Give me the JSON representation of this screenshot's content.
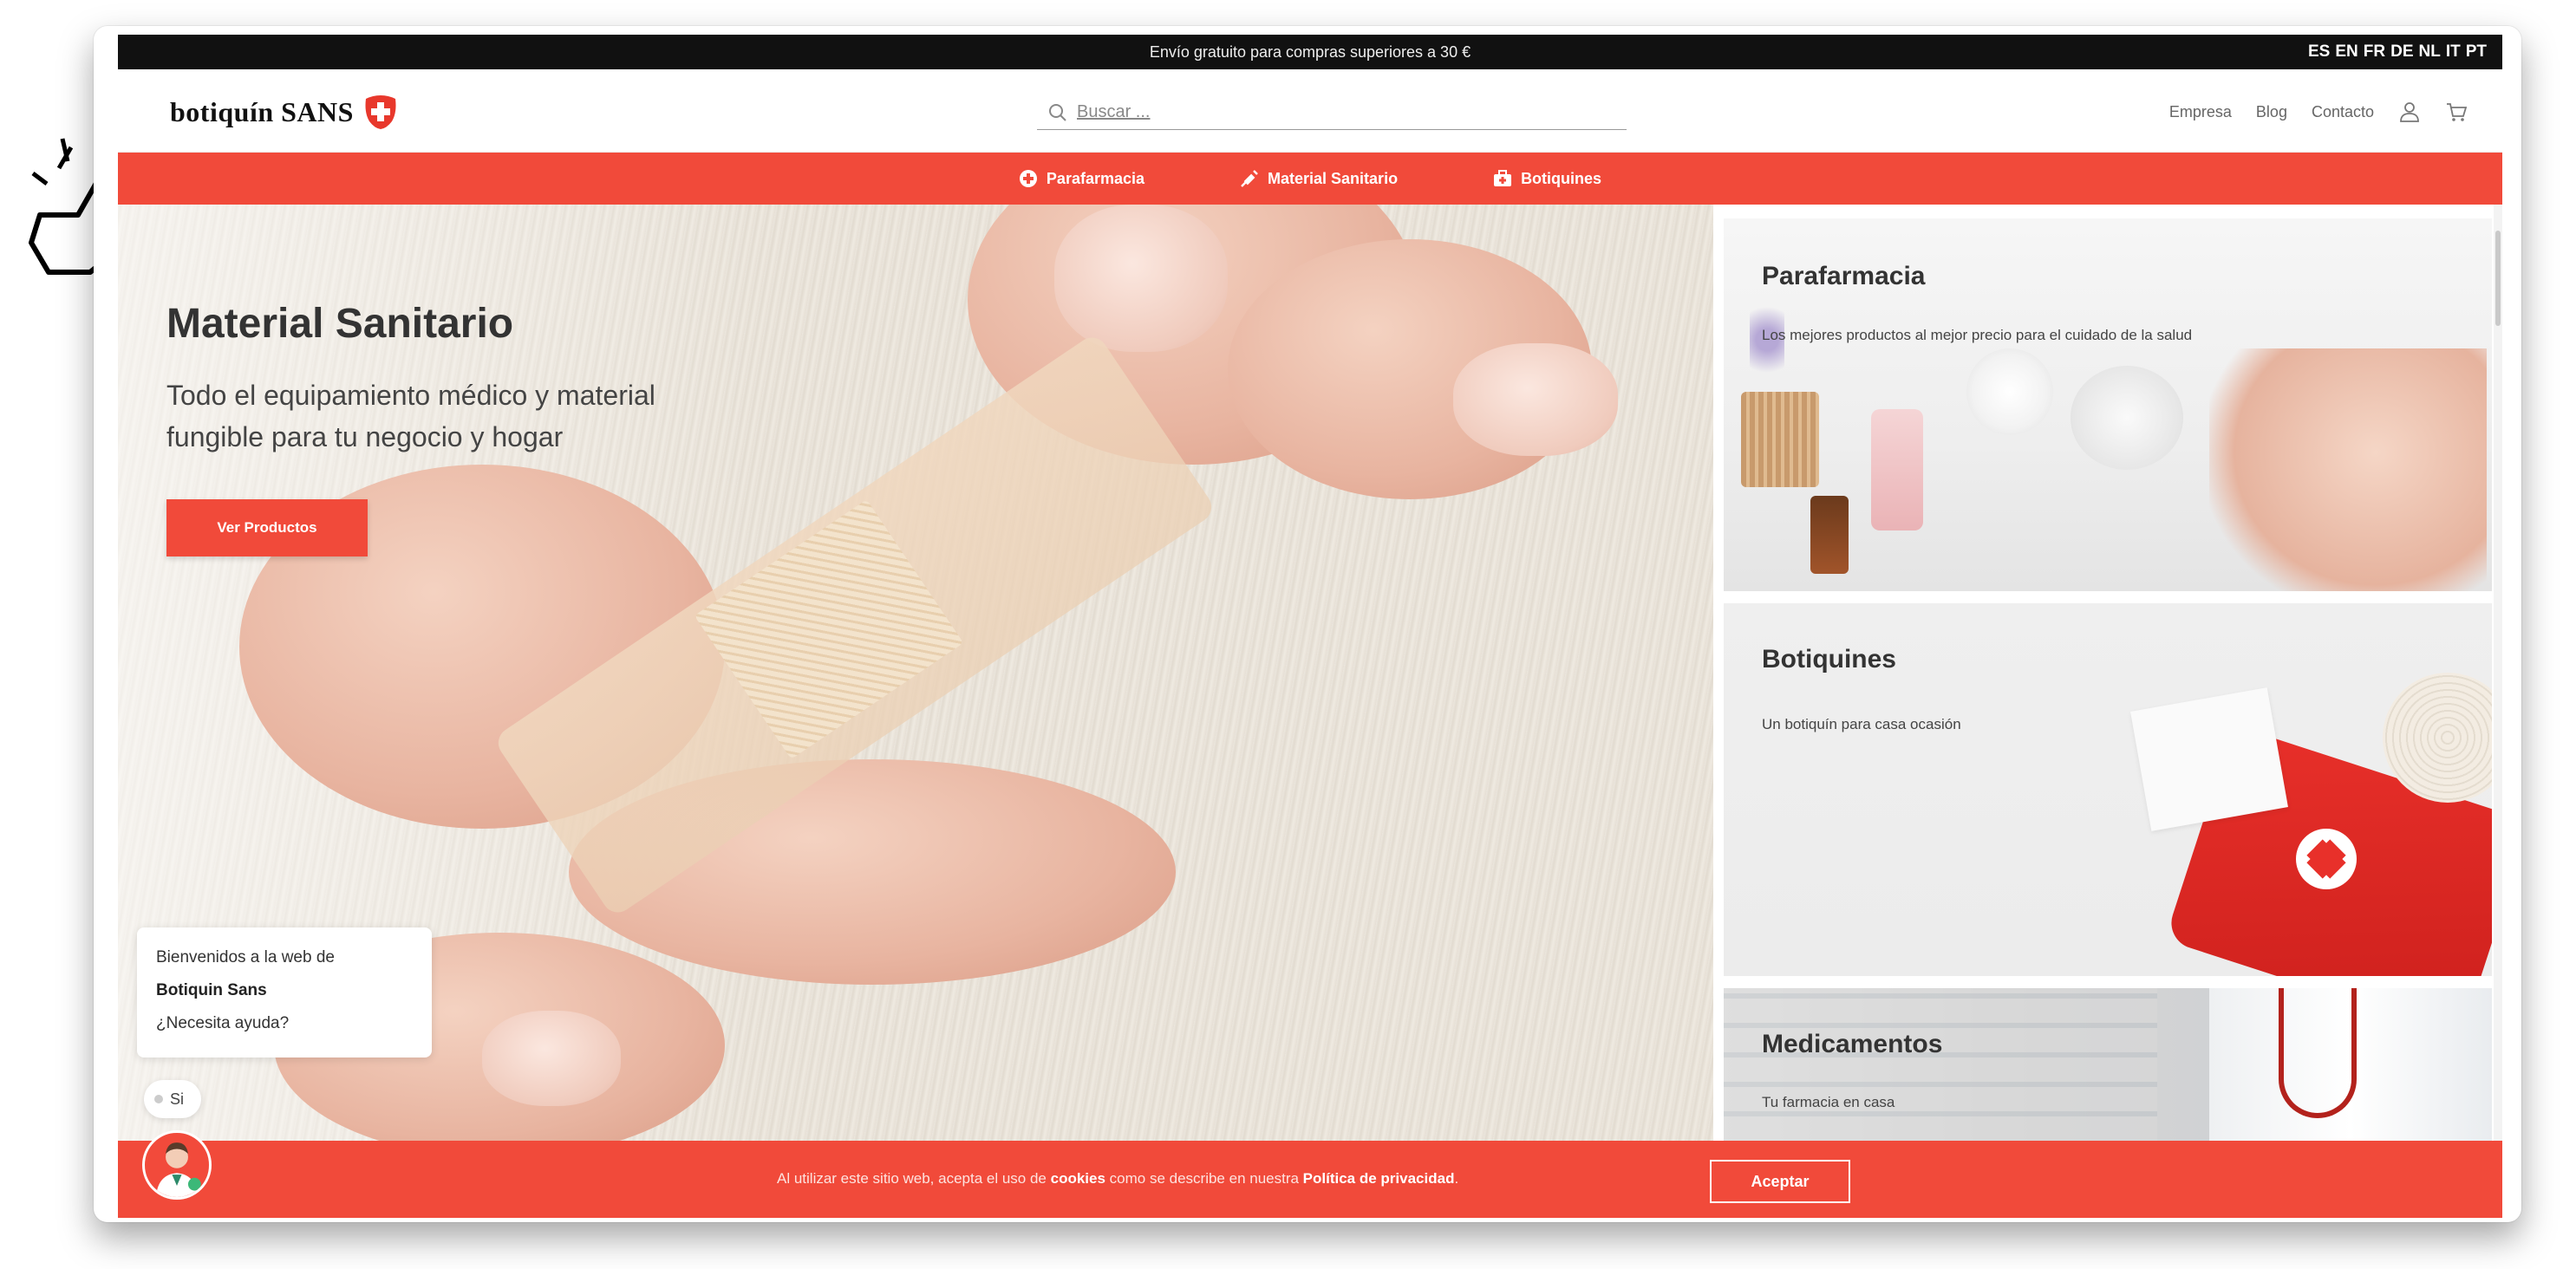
{
  "topbar": {
    "promo": "Envío gratuito para compras superiores a 30 €",
    "languages": [
      "ES",
      "EN",
      "FR",
      "DE",
      "NL",
      "IT",
      "PT"
    ]
  },
  "header": {
    "logo_text": "botiquín SANS",
    "search_placeholder": "Buscar ...",
    "nav": {
      "company": "Empresa",
      "blog": "Blog",
      "contact": "Contacto"
    },
    "icons": [
      "user-icon",
      "cart-icon"
    ]
  },
  "categories": [
    {
      "label": "Parafarmacia",
      "icon": "plus-circle-icon"
    },
    {
      "label": "Material Sanitario",
      "icon": "syringe-icon"
    },
    {
      "label": "Botiquines",
      "icon": "first-aid-kit-icon"
    }
  ],
  "hero": {
    "title": "Material Sanitario",
    "subtitle": "Todo el equipamiento médico y material fungible para tu negocio y hogar",
    "button": "Ver Productos"
  },
  "cards": [
    {
      "title": "Parafarmacia",
      "description": "Los mejores productos al mejor precio para el cuidado de la salud"
    },
    {
      "title": "Botiquines",
      "description": "Un botiquín para casa ocasión"
    },
    {
      "title": "Medicamentos",
      "description": "Tu farmacia en casa"
    }
  ],
  "chat": {
    "line1": "Bienvenidos a la web de",
    "line2": "Botiquin Sans",
    "line3": "¿Necesita ayuda?",
    "reply": "Si"
  },
  "cookie": {
    "message_prefix": "Al utilizar este sitio web, acepta el uso de ",
    "cookies_word": "cookies",
    "message_middle": " como se describe en nuestra ",
    "policy_link": "Política de privacidad",
    "message_suffix": ".",
    "accept_button": "Aceptar"
  },
  "colors": {
    "brand_red": "#f14a3a",
    "topbar_black": "#111111"
  }
}
